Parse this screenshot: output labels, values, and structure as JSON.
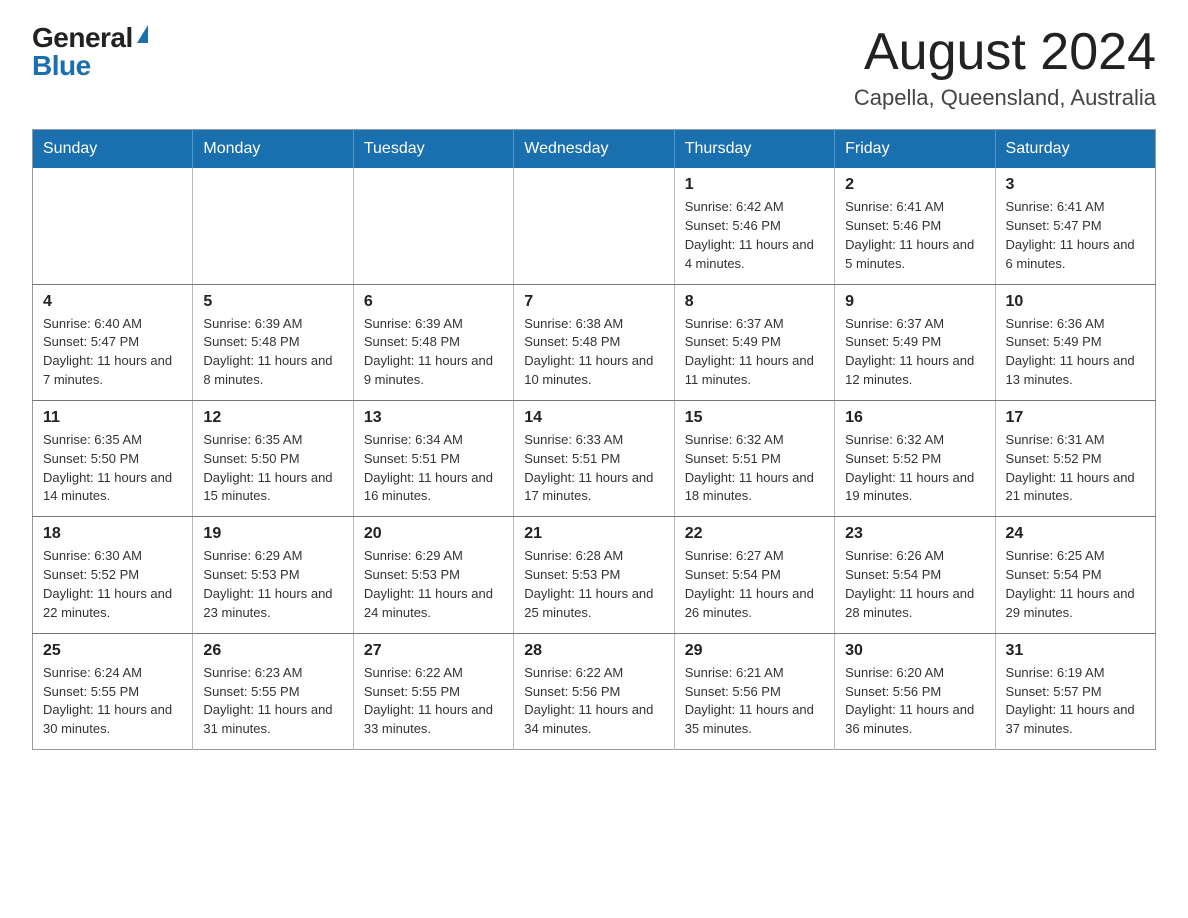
{
  "logo": {
    "general": "General",
    "blue": "Blue"
  },
  "header": {
    "month": "August 2024",
    "location": "Capella, Queensland, Australia"
  },
  "days_of_week": [
    "Sunday",
    "Monday",
    "Tuesday",
    "Wednesday",
    "Thursday",
    "Friday",
    "Saturday"
  ],
  "weeks": [
    [
      {
        "day": "",
        "info": ""
      },
      {
        "day": "",
        "info": ""
      },
      {
        "day": "",
        "info": ""
      },
      {
        "day": "",
        "info": ""
      },
      {
        "day": "1",
        "info": "Sunrise: 6:42 AM\nSunset: 5:46 PM\nDaylight: 11 hours and 4 minutes."
      },
      {
        "day": "2",
        "info": "Sunrise: 6:41 AM\nSunset: 5:46 PM\nDaylight: 11 hours and 5 minutes."
      },
      {
        "day": "3",
        "info": "Sunrise: 6:41 AM\nSunset: 5:47 PM\nDaylight: 11 hours and 6 minutes."
      }
    ],
    [
      {
        "day": "4",
        "info": "Sunrise: 6:40 AM\nSunset: 5:47 PM\nDaylight: 11 hours and 7 minutes."
      },
      {
        "day": "5",
        "info": "Sunrise: 6:39 AM\nSunset: 5:48 PM\nDaylight: 11 hours and 8 minutes."
      },
      {
        "day": "6",
        "info": "Sunrise: 6:39 AM\nSunset: 5:48 PM\nDaylight: 11 hours and 9 minutes."
      },
      {
        "day": "7",
        "info": "Sunrise: 6:38 AM\nSunset: 5:48 PM\nDaylight: 11 hours and 10 minutes."
      },
      {
        "day": "8",
        "info": "Sunrise: 6:37 AM\nSunset: 5:49 PM\nDaylight: 11 hours and 11 minutes."
      },
      {
        "day": "9",
        "info": "Sunrise: 6:37 AM\nSunset: 5:49 PM\nDaylight: 11 hours and 12 minutes."
      },
      {
        "day": "10",
        "info": "Sunrise: 6:36 AM\nSunset: 5:49 PM\nDaylight: 11 hours and 13 minutes."
      }
    ],
    [
      {
        "day": "11",
        "info": "Sunrise: 6:35 AM\nSunset: 5:50 PM\nDaylight: 11 hours and 14 minutes."
      },
      {
        "day": "12",
        "info": "Sunrise: 6:35 AM\nSunset: 5:50 PM\nDaylight: 11 hours and 15 minutes."
      },
      {
        "day": "13",
        "info": "Sunrise: 6:34 AM\nSunset: 5:51 PM\nDaylight: 11 hours and 16 minutes."
      },
      {
        "day": "14",
        "info": "Sunrise: 6:33 AM\nSunset: 5:51 PM\nDaylight: 11 hours and 17 minutes."
      },
      {
        "day": "15",
        "info": "Sunrise: 6:32 AM\nSunset: 5:51 PM\nDaylight: 11 hours and 18 minutes."
      },
      {
        "day": "16",
        "info": "Sunrise: 6:32 AM\nSunset: 5:52 PM\nDaylight: 11 hours and 19 minutes."
      },
      {
        "day": "17",
        "info": "Sunrise: 6:31 AM\nSunset: 5:52 PM\nDaylight: 11 hours and 21 minutes."
      }
    ],
    [
      {
        "day": "18",
        "info": "Sunrise: 6:30 AM\nSunset: 5:52 PM\nDaylight: 11 hours and 22 minutes."
      },
      {
        "day": "19",
        "info": "Sunrise: 6:29 AM\nSunset: 5:53 PM\nDaylight: 11 hours and 23 minutes."
      },
      {
        "day": "20",
        "info": "Sunrise: 6:29 AM\nSunset: 5:53 PM\nDaylight: 11 hours and 24 minutes."
      },
      {
        "day": "21",
        "info": "Sunrise: 6:28 AM\nSunset: 5:53 PM\nDaylight: 11 hours and 25 minutes."
      },
      {
        "day": "22",
        "info": "Sunrise: 6:27 AM\nSunset: 5:54 PM\nDaylight: 11 hours and 26 minutes."
      },
      {
        "day": "23",
        "info": "Sunrise: 6:26 AM\nSunset: 5:54 PM\nDaylight: 11 hours and 28 minutes."
      },
      {
        "day": "24",
        "info": "Sunrise: 6:25 AM\nSunset: 5:54 PM\nDaylight: 11 hours and 29 minutes."
      }
    ],
    [
      {
        "day": "25",
        "info": "Sunrise: 6:24 AM\nSunset: 5:55 PM\nDaylight: 11 hours and 30 minutes."
      },
      {
        "day": "26",
        "info": "Sunrise: 6:23 AM\nSunset: 5:55 PM\nDaylight: 11 hours and 31 minutes."
      },
      {
        "day": "27",
        "info": "Sunrise: 6:22 AM\nSunset: 5:55 PM\nDaylight: 11 hours and 33 minutes."
      },
      {
        "day": "28",
        "info": "Sunrise: 6:22 AM\nSunset: 5:56 PM\nDaylight: 11 hours and 34 minutes."
      },
      {
        "day": "29",
        "info": "Sunrise: 6:21 AM\nSunset: 5:56 PM\nDaylight: 11 hours and 35 minutes."
      },
      {
        "day": "30",
        "info": "Sunrise: 6:20 AM\nSunset: 5:56 PM\nDaylight: 11 hours and 36 minutes."
      },
      {
        "day": "31",
        "info": "Sunrise: 6:19 AM\nSunset: 5:57 PM\nDaylight: 11 hours and 37 minutes."
      }
    ]
  ]
}
